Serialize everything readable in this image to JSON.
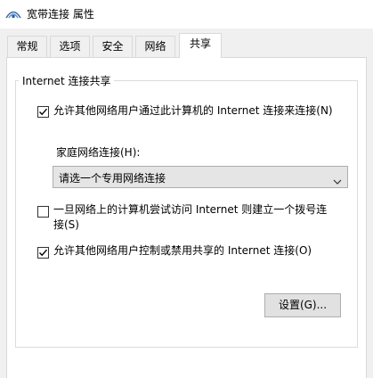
{
  "window": {
    "title": "宽带连接 属性"
  },
  "tabs": [
    {
      "label": "常规"
    },
    {
      "label": "选项"
    },
    {
      "label": "安全"
    },
    {
      "label": "网络"
    },
    {
      "label": "共享"
    }
  ],
  "active_tab": "共享",
  "group": {
    "title": "Internet 连接共享",
    "allow_share": {
      "label": "允许其他网络用户通过此计算机的 Internet 连接来连接(N)",
      "checked": true
    },
    "home_network": {
      "label": "家庭网络连接(H):",
      "selected": "请选一个专用网络连接"
    },
    "dial_on_demand": {
      "label_line1": "一旦网络上的计算机尝试访问 Internet 则建立一个拨号连",
      "label_line2": "接(S)",
      "checked": false
    },
    "allow_control": {
      "label": "允许其他网络用户控制或禁用共享的 Internet 连接(O)",
      "checked": true
    },
    "settings_button": "设置(G)..."
  },
  "icons": {
    "window": "network-connection-icon",
    "dropdown": "chevron-down-icon",
    "check": "checkmark-icon"
  }
}
